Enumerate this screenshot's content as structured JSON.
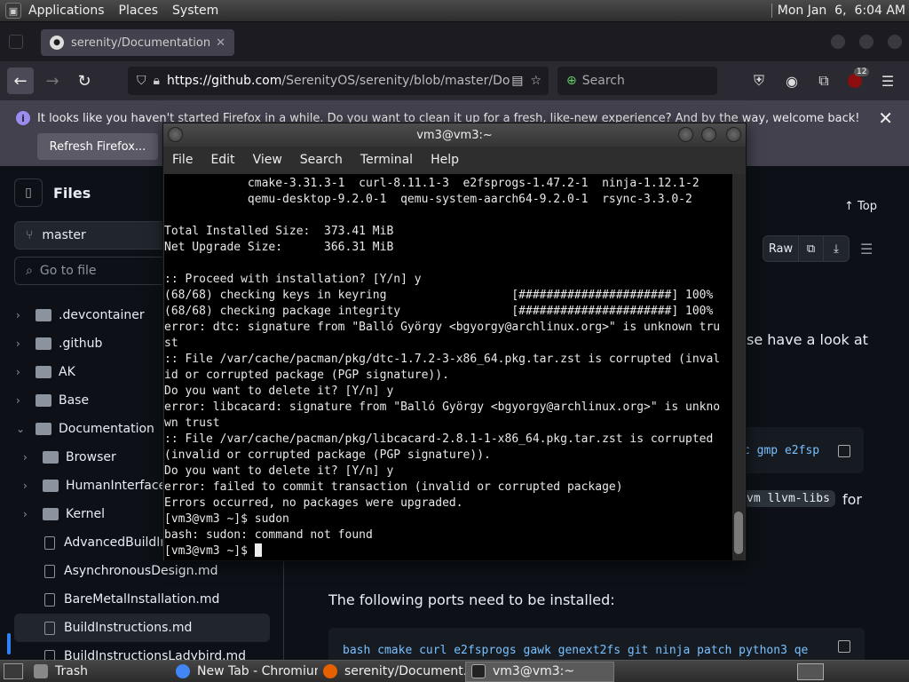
{
  "top_panel": {
    "menus": [
      "Applications",
      "Places",
      "System"
    ],
    "clock": "Mon Jan  6,  6:04 AM"
  },
  "firefox": {
    "tab_title": "serenity/Documentation/Bu",
    "url_host": "https://github.com",
    "url_path": "/SerenityOS/serenity/blob/master/Do",
    "search_placeholder": "Search",
    "ublock_badge": "12",
    "notification": "It looks like you haven't started Firefox in a while. Do you want to clean it up for a fresh, like-new experience? And by the way, welcome back!",
    "refresh_label": "Refresh Firefox..."
  },
  "github": {
    "files_title": "Files",
    "branch": "master",
    "goto_placeholder": "Go to file",
    "tree": [
      {
        "type": "folder",
        "name": ".devcontainer",
        "depth": 0,
        "open": false
      },
      {
        "type": "folder",
        "name": ".github",
        "depth": 0,
        "open": false
      },
      {
        "type": "folder",
        "name": "AK",
        "depth": 0,
        "open": false
      },
      {
        "type": "folder",
        "name": "Base",
        "depth": 0,
        "open": false
      },
      {
        "type": "folder",
        "name": "Documentation",
        "depth": 0,
        "open": true
      },
      {
        "type": "folder",
        "name": "Browser",
        "depth": 1,
        "open": false
      },
      {
        "type": "folder",
        "name": "HumanInterfaceG",
        "depth": 1,
        "open": false
      },
      {
        "type": "folder",
        "name": "Kernel",
        "depth": 1,
        "open": false
      },
      {
        "type": "file",
        "name": "AdvancedBuildIns",
        "depth": 1
      },
      {
        "type": "file",
        "name": "AsynchronousDesign.md",
        "depth": 1
      },
      {
        "type": "file",
        "name": "BareMetalInstallation.md",
        "depth": 1
      },
      {
        "type": "file",
        "name": "BuildInstructions.md",
        "depth": 1,
        "active": true
      },
      {
        "type": "file",
        "name": "BuildInstructionsLadybird.md",
        "depth": 1
      }
    ],
    "top_label": "Top",
    "raw_label": "Raw",
    "partial_text_1": "se have a look at",
    "partial_code_1": "c gmp e2fsp",
    "partial_code_2": "vm llvm-libs",
    "partial_text_2": "for",
    "ports_text": "The following ports need to be installed:",
    "ports_code": "bash cmake curl e2fsprogs gawk genext2fs git ninja patch python3 qe"
  },
  "terminal": {
    "title": "vm3@vm3:~",
    "menu": [
      "File",
      "Edit",
      "View",
      "Search",
      "Terminal",
      "Help"
    ],
    "lines": [
      "            cmake-3.31.3-1  curl-8.11.1-3  e2fsprogs-1.47.2-1  ninja-1.12.1-2",
      "            qemu-desktop-9.2.0-1  qemu-system-aarch64-9.2.0-1  rsync-3.3.0-2",
      "",
      "Total Installed Size:  373.41 MiB",
      "Net Upgrade Size:      366.31 MiB",
      "",
      ":: Proceed with installation? [Y/n] y",
      "(68/68) checking keys in keyring                  [######################] 100%",
      "(68/68) checking package integrity                [######################] 100%",
      "error: dtc: signature from \"Balló György <bgyorgy@archlinux.org>\" is unknown tru",
      "st",
      ":: File /var/cache/pacman/pkg/dtc-1.7.2-3-x86_64.pkg.tar.zst is corrupted (inval",
      "id or corrupted package (PGP signature)).",
      "Do you want to delete it? [Y/n] y",
      "error: libcacard: signature from \"Balló György <bgyorgy@archlinux.org>\" is unkno",
      "wn trust",
      ":: File /var/cache/pacman/pkg/libcacard-2.8.1-1-x86_64.pkg.tar.zst is corrupted",
      "(invalid or corrupted package (PGP signature)).",
      "Do you want to delete it? [Y/n] y",
      "error: failed to commit transaction (invalid or corrupted package)",
      "Errors occurred, no packages were upgraded.",
      "[vm3@vm3 ~]$ sudon",
      "bash: sudon: command not found"
    ],
    "prompt": "[vm3@vm3 ~]$ "
  },
  "taskbar": {
    "items": [
      {
        "label": "Trash",
        "icon": "trash-icon"
      },
      {
        "label": "New Tab - Chromium",
        "icon": "chromium-icon"
      },
      {
        "label": "serenity/Document...",
        "icon": "firefox-icon"
      },
      {
        "label": "vm3@vm3:~",
        "icon": "terminal-icon",
        "active": true
      }
    ]
  }
}
